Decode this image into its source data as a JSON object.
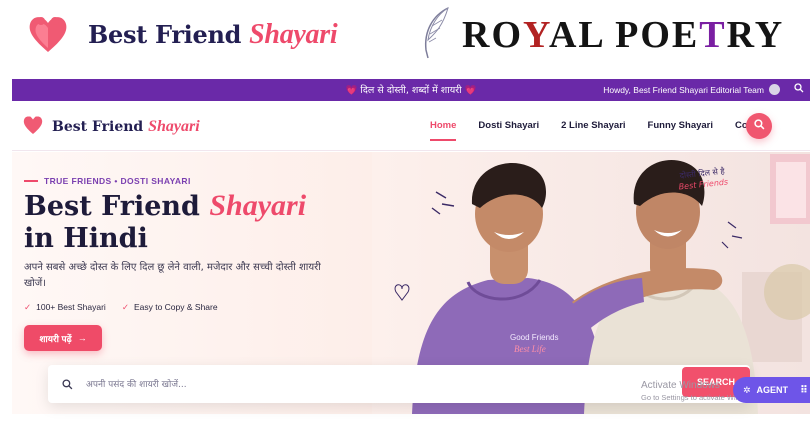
{
  "banner": {
    "left_logo": {
      "name_part1": "Best Friend",
      "name_part2": "Shayari"
    },
    "right_logo": {
      "text_a": "RO",
      "text_y": "Y",
      "text_b": "AL POE",
      "text_t": "T",
      "text_c": "RY"
    }
  },
  "topbar": {
    "center_text": "💗 दिल से दोस्ती, शब्दों में शायरी 💗",
    "howdy_text": "Howdy, Best Friend Shayari Editorial Team"
  },
  "header": {
    "brand_part1": "Best Friend",
    "brand_part2": "Shayari",
    "nav": [
      {
        "label": "Home",
        "active": true
      },
      {
        "label": "Dosti Shayari"
      },
      {
        "label": "2 Line Shayari"
      },
      {
        "label": "Funny Shayari"
      },
      {
        "label": "Contact"
      }
    ]
  },
  "hero": {
    "eyebrow": "TRUE FRIENDS • DOSTI SHAYARI",
    "title_part1": "Best Friend ",
    "title_part2": "Shayari",
    "title_line2": "in Hindi",
    "subtitle": "अपने सबसे अच्छे दोस्त के लिए दिल छू लेने वाली, मजेदार और सच्ची दोस्ती शायरी खोजें।",
    "features": [
      "100+ Best Shayari",
      "Easy to Copy & Share"
    ],
    "cta_label": "शायरी पढ़ें",
    "photo_caption_line1": "दोस्ती दिल से है",
    "photo_caption_line2": "Best Friends",
    "hoodie_text_1": "Good Friends",
    "hoodie_text_2": "Best Life"
  },
  "search": {
    "placeholder": "अपनी पसंद की शायरी खोजें...",
    "button_label": "SEARCH"
  },
  "overlay": {
    "activate_line1": "Activate Windows",
    "activate_line2": "Go to Settings to activate Windows.",
    "agent_label": "AGENT"
  },
  "colors": {
    "accent": "#ee4a6b",
    "purple": "#6a29a8",
    "navy": "#231f52",
    "agent": "#6e55e8"
  },
  "icons": [
    "heart-logo-icon",
    "feather-quill-icon",
    "search-icon",
    "user-avatar-icon",
    "arrow-right-icon",
    "check-icon",
    "sparkle-icon",
    "grid-dots-icon"
  ]
}
